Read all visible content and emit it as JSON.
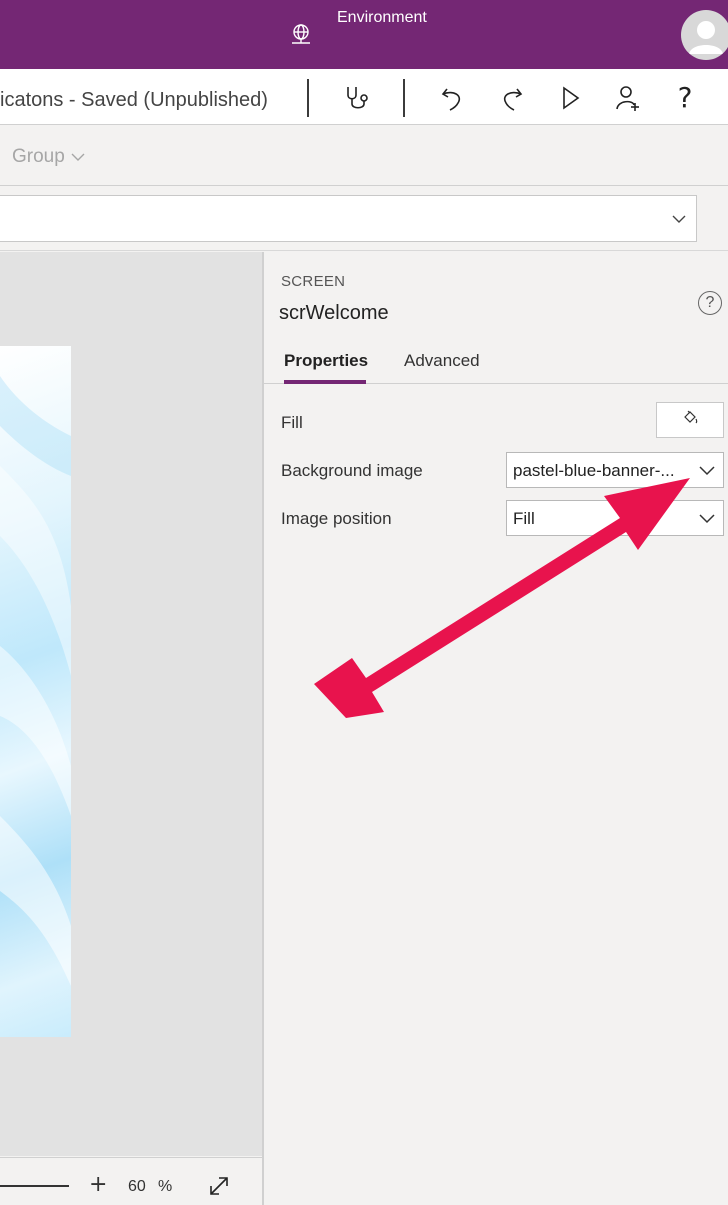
{
  "header": {
    "environment_label": "Environment",
    "environment_icon": "globe-icon",
    "avatar_icon": "user-avatar-icon"
  },
  "command_bar": {
    "app_title": "icatons - Saved (Unpublished)",
    "buttons": [
      "stethoscope-icon",
      "undo-icon",
      "redo-icon",
      "play-icon",
      "share-user-icon",
      "help-icon"
    ],
    "help_label": "?"
  },
  "ribbon": {
    "group_label": "Group"
  },
  "zoom": {
    "plus_label": "+",
    "value": "60",
    "unit": "%"
  },
  "properties_panel": {
    "object_type": "SCREEN",
    "object_name": "scrWelcome",
    "help_label": "?",
    "tabs": [
      {
        "label": "Properties",
        "active": true
      },
      {
        "label": "Advanced",
        "active": false
      }
    ],
    "fill_label": "Fill",
    "background_image_label": "Background image",
    "background_image_value": "pastel-blue-banner-...",
    "image_position_label": "Image position",
    "image_position_value": "Fill"
  },
  "colors": {
    "brand_purple": "#742774",
    "annotation_arrow": "#e8134d"
  }
}
